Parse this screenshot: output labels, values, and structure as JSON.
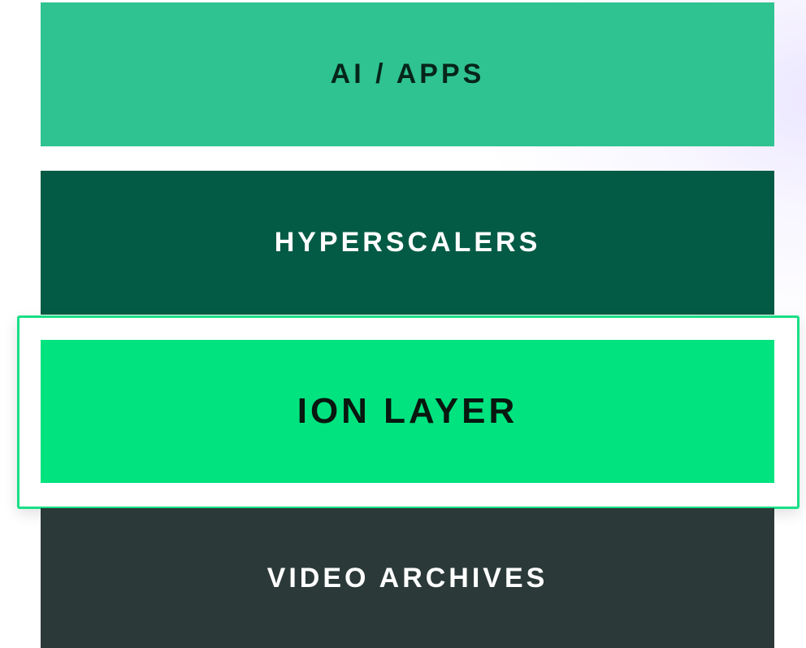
{
  "layers": [
    {
      "label": "AI / APPS",
      "color": "#2fc391",
      "text_color": "#06251a"
    },
    {
      "label": "HYPERSCALERS",
      "color": "#045b45",
      "text_color": "#ffffff"
    },
    {
      "label": "ION LAYER",
      "color": "#00e37f",
      "text_color": "#08170f",
      "highlighted": true
    },
    {
      "label": "VIDEO ARCHIVES",
      "color": "#2b3a38",
      "text_color": "#ffffff"
    }
  ],
  "highlight_border_color": "#18df86"
}
